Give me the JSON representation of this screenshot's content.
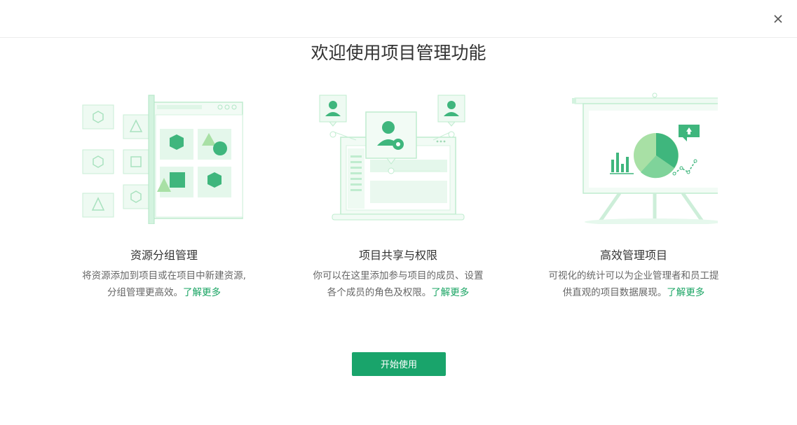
{
  "dialog": {
    "title": "欢迎使用项目管理功能",
    "close_icon": "close-icon",
    "start_button": "开始使用"
  },
  "features": [
    {
      "illustration": "resource-grouping-illustration",
      "title": "资源分组管理",
      "desc_line1": "将资源添加到项目或在项目中新建资源,",
      "desc_line2": "分组管理更高效。",
      "learn_more": "了解更多"
    },
    {
      "illustration": "member-sharing-illustration",
      "title": "项目共享与权限",
      "desc_line1": "你可以在这里添加参与项目的成员、设置",
      "desc_line2": "各个成员的角色及权限。",
      "learn_more": "了解更多"
    },
    {
      "illustration": "presentation-board-illustration",
      "title": "高效管理项目",
      "desc_line1": "可视化的统计可以为企业管理者和员工提",
      "desc_line2": "供直观的项目数据展现。",
      "learn_more": "了解更多"
    }
  ],
  "colors": {
    "accent": "#19a46b",
    "link": "#19a463",
    "illustration_light": "#e8f8ee",
    "illustration_line": "#bfeccf",
    "illustration_dark": "#3fb67d"
  }
}
